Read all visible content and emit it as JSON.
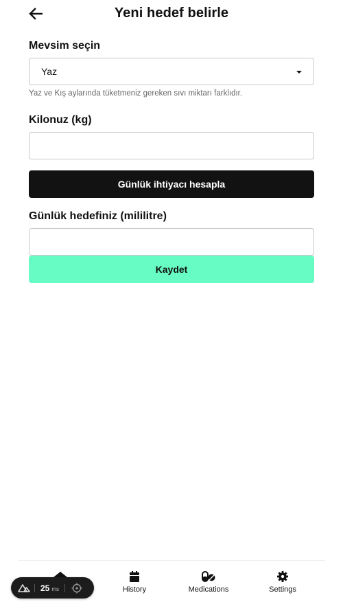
{
  "header": {
    "title": "Yeni hedef belirle",
    "back_icon": "arrow-left-icon"
  },
  "form": {
    "season_label": "Mevsim seçin",
    "season_value": "Yaz",
    "season_helper": "Yaz ve Kış aylarında tüketmeniz gereken sıvı miktarı farklıdır.",
    "weight_label": "Kilonuz (kg)",
    "weight_value": "",
    "calc_button": "Günlük ihtiyacı hesapla",
    "goal_label": "Günlük hedefiniz (mililitre)",
    "goal_value": "",
    "save_button": "Kaydet"
  },
  "tabs": [
    {
      "label": "",
      "icon": "home-icon"
    },
    {
      "label": "History",
      "icon": "calendar-icon"
    },
    {
      "label": "Medications",
      "icon": "pills-icon"
    },
    {
      "label": "Settings",
      "icon": "gear-icon"
    }
  ],
  "devtools": {
    "value": "25",
    "unit": "ms"
  },
  "colors": {
    "primary_dark": "#121212",
    "accent_green": "#66fcc3"
  }
}
